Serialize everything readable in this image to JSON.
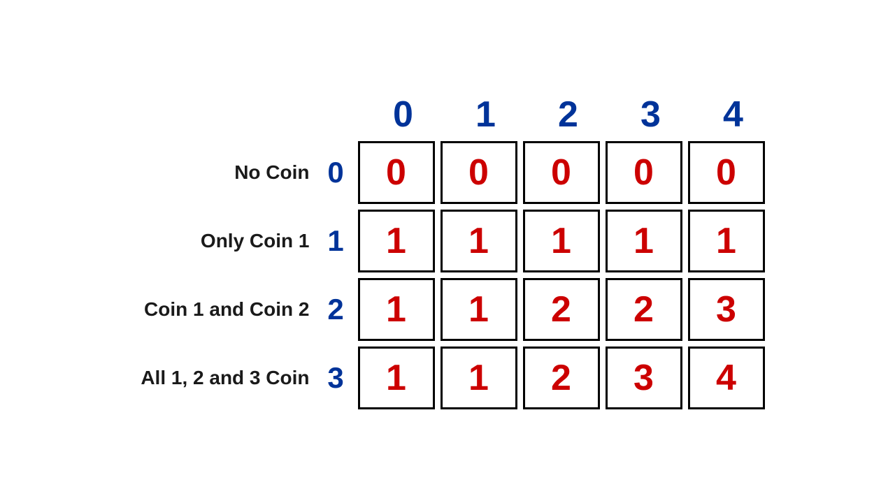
{
  "header": {
    "col_headers": [
      "0",
      "1",
      "2",
      "3",
      "4"
    ]
  },
  "rows": [
    {
      "label": "No Coin",
      "index": "0",
      "cells": [
        "0",
        "0",
        "0",
        "0",
        "0"
      ]
    },
    {
      "label": "Only Coin 1",
      "index": "1",
      "cells": [
        "1",
        "1",
        "1",
        "1",
        "1"
      ]
    },
    {
      "label": "Coin 1 and Coin 2",
      "index": "2",
      "cells": [
        "1",
        "1",
        "2",
        "2",
        "3"
      ]
    },
    {
      "label": "All 1, 2 and 3 Coin",
      "index": "3",
      "cells": [
        "1",
        "1",
        "2",
        "3",
        "4"
      ]
    }
  ]
}
